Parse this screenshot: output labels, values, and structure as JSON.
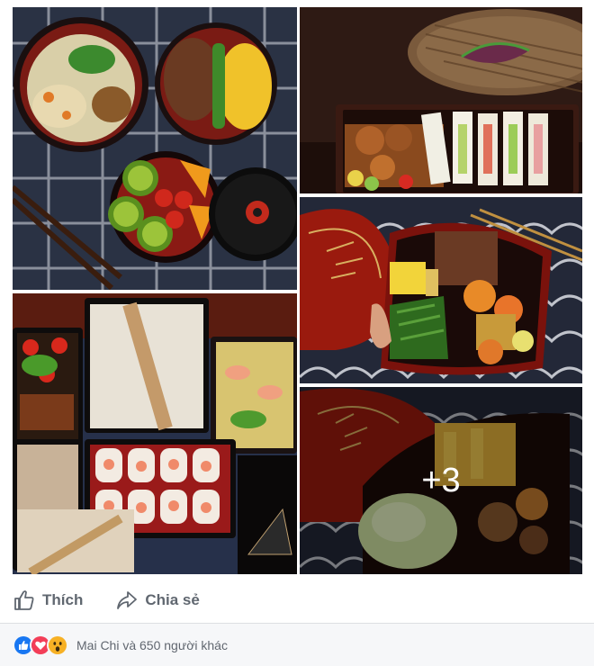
{
  "gallery": {
    "photos": [
      {
        "subject": "lacquer bowls with salad, rice, green beans and fruit"
      },
      {
        "subject": "bamboo box with sandwiches and fried chicken"
      },
      {
        "subject": "tiered boxes with rice, grilled pork and spring rolls"
      },
      {
        "subject": "red lacquer bento with vegetables and chicken"
      },
      {
        "subject": "red lacquer bento with cabbage and stew"
      }
    ],
    "more_count": "+3"
  },
  "actions": {
    "like_label": "Thích",
    "share_label": "Chia sẻ"
  },
  "reactions": {
    "summary": "Mai Chi và 650 người khác",
    "icons": [
      "like-icon",
      "love-icon",
      "wow-icon"
    ],
    "colors": {
      "like": "#1877f2",
      "love": "#f33e58",
      "wow": "#f7b125"
    }
  }
}
